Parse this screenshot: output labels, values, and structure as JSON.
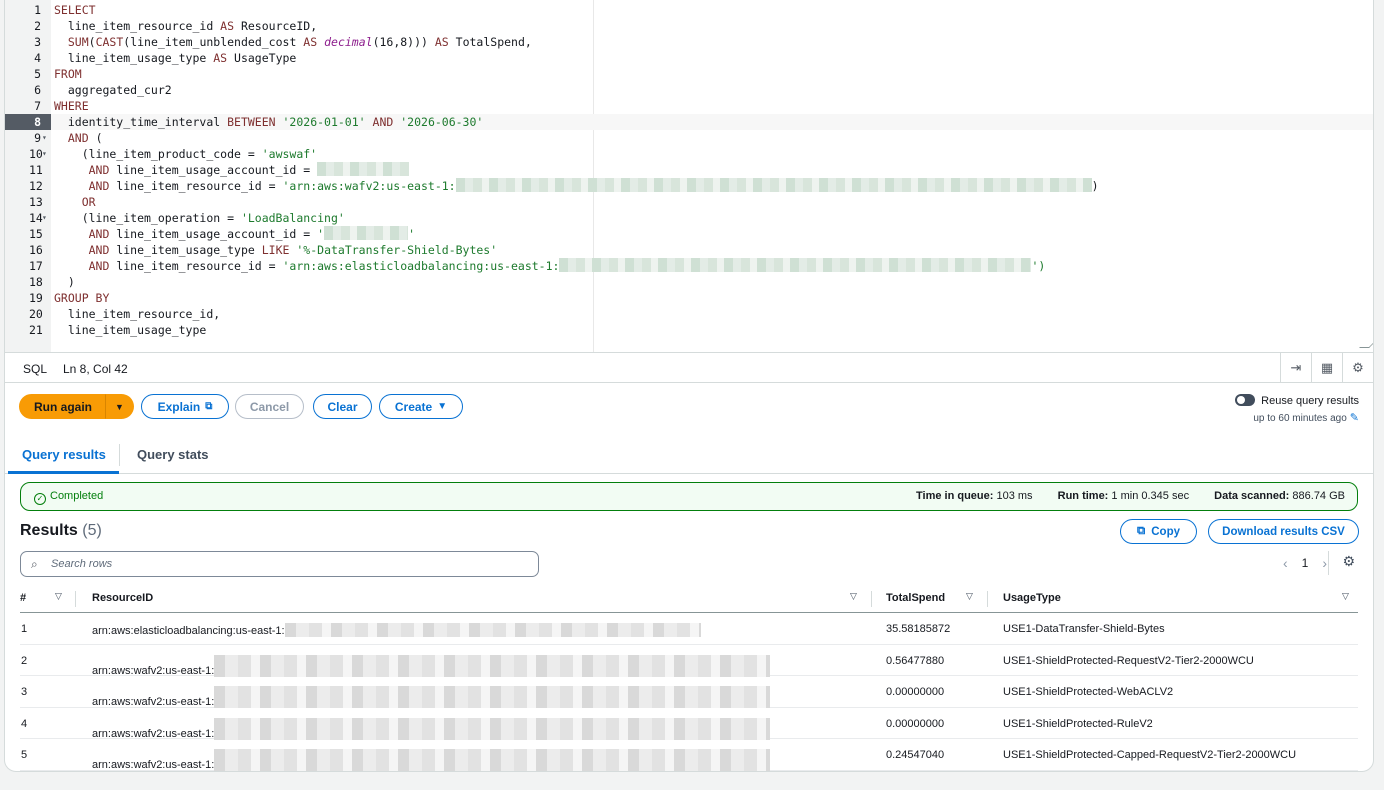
{
  "editor": {
    "lines": [
      {
        "n": "1",
        "fold": false,
        "html_parts": [
          [
            "kw",
            "SELECT"
          ]
        ]
      },
      {
        "n": "2",
        "fold": false,
        "html_parts": [
          [
            "",
            "  line_item_resource_id "
          ],
          [
            "kw",
            "AS"
          ],
          [
            "",
            " ResourceID,"
          ]
        ]
      },
      {
        "n": "3",
        "fold": false,
        "html_parts": [
          [
            "",
            "  "
          ],
          [
            "kw",
            "SUM"
          ],
          [
            "",
            "("
          ],
          [
            "kw",
            "CAST"
          ],
          [
            "",
            "(line_item_unblended_cost "
          ],
          [
            "kw",
            "AS"
          ],
          [
            "",
            " "
          ],
          [
            "fn",
            "decimal"
          ],
          [
            "",
            "(16,8))) "
          ],
          [
            "kw",
            "AS"
          ],
          [
            "",
            " TotalSpend,"
          ]
        ]
      },
      {
        "n": "4",
        "fold": false,
        "html_parts": [
          [
            "",
            "  line_item_usage_type "
          ],
          [
            "kw",
            "AS"
          ],
          [
            "",
            " UsageType"
          ]
        ]
      },
      {
        "n": "5",
        "fold": false,
        "html_parts": [
          [
            "kw",
            "FROM"
          ]
        ]
      },
      {
        "n": "6",
        "fold": false,
        "html_parts": [
          [
            "",
            "  aggregated_cur2"
          ]
        ]
      },
      {
        "n": "7",
        "fold": false,
        "html_parts": [
          [
            "kw",
            "WHERE"
          ]
        ]
      },
      {
        "n": "8",
        "fold": false,
        "active": true,
        "html_parts": [
          [
            "",
            "  identity_time_interval "
          ],
          [
            "kw",
            "BETWEEN"
          ],
          [
            "",
            " "
          ],
          [
            "str",
            "'2026-01-01'"
          ],
          [
            "",
            " "
          ],
          [
            "kw",
            "AND"
          ],
          [
            "",
            " "
          ],
          [
            "str",
            "'2026-06-30'"
          ]
        ]
      },
      {
        "n": "9",
        "fold": true,
        "html_parts": [
          [
            "",
            "  "
          ],
          [
            "kw",
            "AND"
          ],
          [
            "",
            " ("
          ]
        ]
      },
      {
        "n": "10",
        "fold": true,
        "html_parts": [
          [
            "",
            "    (line_item_product_code = "
          ],
          [
            "str",
            "'awswaf'"
          ]
        ]
      },
      {
        "n": "11",
        "fold": false,
        "html_parts": [
          [
            "",
            "     "
          ],
          [
            "kw",
            "AND"
          ],
          [
            "",
            " line_item_usage_account_id = "
          ],
          [
            "redact",
            "92"
          ]
        ]
      },
      {
        "n": "12",
        "fold": false,
        "html_parts": [
          [
            "",
            "     "
          ],
          [
            "kw",
            "AND"
          ],
          [
            "",
            " line_item_resource_id = "
          ],
          [
            "str",
            "'arn:aws:wafv2:us-east-1:"
          ],
          [
            "redact",
            "636"
          ],
          [
            "",
            ")"
          ]
        ]
      },
      {
        "n": "13",
        "fold": false,
        "html_parts": [
          [
            "",
            "    "
          ],
          [
            "kw",
            "OR"
          ]
        ]
      },
      {
        "n": "14",
        "fold": true,
        "html_parts": [
          [
            "",
            "    (line_item_operation = "
          ],
          [
            "str",
            "'LoadBalancing'"
          ]
        ]
      },
      {
        "n": "15",
        "fold": false,
        "html_parts": [
          [
            "",
            "     "
          ],
          [
            "kw",
            "AND"
          ],
          [
            "",
            " line_item_usage_account_id = "
          ],
          [
            "str",
            "'"
          ],
          [
            "redact",
            "84"
          ],
          [
            "str",
            "'"
          ]
        ]
      },
      {
        "n": "16",
        "fold": false,
        "html_parts": [
          [
            "",
            "     "
          ],
          [
            "kw",
            "AND"
          ],
          [
            "",
            " line_item_usage_type "
          ],
          [
            "kw",
            "LIKE"
          ],
          [
            "",
            " "
          ],
          [
            "str",
            "'%-DataTransfer-Shield-Bytes'"
          ]
        ]
      },
      {
        "n": "17",
        "fold": false,
        "html_parts": [
          [
            "",
            "     "
          ],
          [
            "kw",
            "AND"
          ],
          [
            "",
            " line_item_resource_id = "
          ],
          [
            "str",
            "'arn:aws:elasticloadbalancing:us-east-1:"
          ],
          [
            "redact",
            "472"
          ],
          [
            "str",
            "')"
          ]
        ]
      },
      {
        "n": "18",
        "fold": false,
        "html_parts": [
          [
            "",
            "  )"
          ]
        ]
      },
      {
        "n": "19",
        "fold": false,
        "html_parts": [
          [
            "kw",
            "GROUP BY"
          ]
        ]
      },
      {
        "n": "20",
        "fold": false,
        "html_parts": [
          [
            "",
            "  line_item_resource_id,"
          ]
        ]
      },
      {
        "n": "21",
        "fold": false,
        "html_parts": [
          [
            "",
            "  line_item_usage_type"
          ]
        ]
      }
    ]
  },
  "statusbar": {
    "language": "SQL",
    "position": "Ln 8, Col 42"
  },
  "actions": {
    "run_again": "Run again",
    "explain": "Explain",
    "cancel": "Cancel",
    "clear": "Clear",
    "create": "Create",
    "reuse_label": "Reuse query results",
    "reuse_sub": "up to 60 minutes ago"
  },
  "tabs": {
    "results": "Query results",
    "stats": "Query stats"
  },
  "status": {
    "state": "Completed",
    "queue_label": "Time in queue:",
    "queue_value": "103 ms",
    "run_label": "Run time:",
    "run_value": "1 min 0.345 sec",
    "scanned_label": "Data scanned:",
    "scanned_value": "886.74 GB"
  },
  "results": {
    "title": "Results",
    "count": "(5)",
    "copy": "Copy",
    "download": "Download results CSV",
    "search_placeholder": "Search rows",
    "page": "1",
    "columns": [
      "#",
      "ResourceID",
      "TotalSpend",
      "UsageType"
    ],
    "rows": [
      {
        "n": "1",
        "resource": "arn:aws:elasticloadbalancing:us-east-1:",
        "redact_w": 416,
        "spend": "35.58185872",
        "usage": "USE1-DataTransfer-Shield-Bytes"
      },
      {
        "n": "2",
        "resource": "arn:aws:wafv2:us-east-1:",
        "redact_w": 556,
        "spend": "0.56477880",
        "usage": "USE1-ShieldProtected-RequestV2-Tier2-2000WCU"
      },
      {
        "n": "3",
        "resource": "arn:aws:wafv2:us-east-1:",
        "redact_w": 556,
        "spend": "0.00000000",
        "usage": "USE1-ShieldProtected-WebACLV2"
      },
      {
        "n": "4",
        "resource": "arn:aws:wafv2:us-east-1:",
        "redact_w": 556,
        "spend": "0.00000000",
        "usage": "USE1-ShieldProtected-RuleV2"
      },
      {
        "n": "5",
        "resource": "arn:aws:wafv2:us-east-1:",
        "redact_w": 556,
        "spend": "0.24547040",
        "usage": "USE1-ShieldProtected-Capped-RequestV2-Tier2-2000WCU"
      }
    ]
  },
  "colors": {
    "primary": "#f89b05",
    "link": "#0972d3",
    "success": "#037f0c"
  }
}
